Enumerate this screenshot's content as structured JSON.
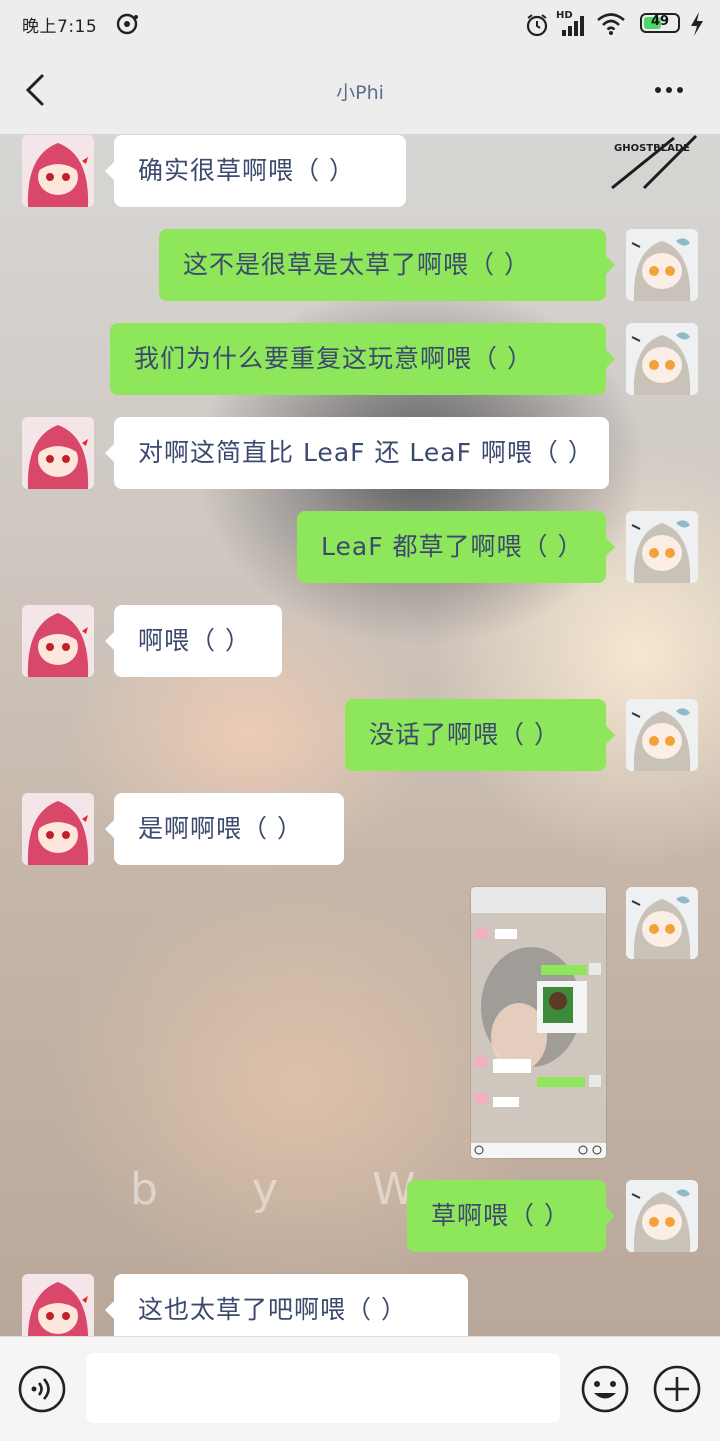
{
  "status_bar": {
    "time": "晚上7:15",
    "network": "HD",
    "battery": "49",
    "icons": [
      "alarm-icon",
      "signal-icon",
      "wifi-icon",
      "battery-icon",
      "charging-icon"
    ]
  },
  "header": {
    "title": "小Phi",
    "back_icon": "chevron-left-icon",
    "more_icon": "more-dots-icon"
  },
  "background": {
    "logo_text": "GHOSTBLADE",
    "watermark": "b y W"
  },
  "messages": [
    {
      "side": "left",
      "text": "确实很草啊喂（ ）"
    },
    {
      "side": "right",
      "text": "这不是很草是太草了啊喂（ ）"
    },
    {
      "side": "right",
      "text": "我们为什么要重复这玩意啊喂（ ）"
    },
    {
      "side": "left",
      "text": "对啊这简直比 LeaF 还 LeaF 啊喂（ ）"
    },
    {
      "side": "right",
      "text": "LeaF 都草了啊喂（ ）"
    },
    {
      "side": "left",
      "text": "啊喂（ ）"
    },
    {
      "side": "right",
      "text": "没话了啊喂（ ）"
    },
    {
      "side": "left",
      "text": "是啊啊喂（ ）"
    },
    {
      "side": "right",
      "type": "image",
      "text": ""
    },
    {
      "side": "right",
      "text": "草啊喂（ ）"
    },
    {
      "side": "left",
      "text": "这也太草了吧啊喂（ ）"
    }
  ],
  "input_bar": {
    "voice_icon": "voice-icon",
    "text_value": "",
    "emoji_icon": "emoji-icon",
    "plus_icon": "plus-icon"
  },
  "colors": {
    "bubble_self": "#8ee65b",
    "bubble_other": "#ffffff",
    "text": "#3c4a6e",
    "bar": "#ededed"
  }
}
